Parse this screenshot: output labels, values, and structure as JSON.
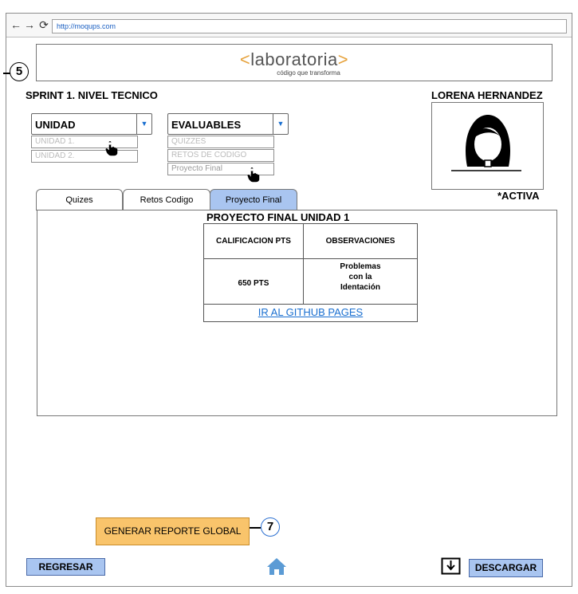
{
  "browser": {
    "url": "http://moqups.com",
    "icons": {
      "back": "arrow-left",
      "forward": "arrow-right",
      "reload": "reload"
    }
  },
  "logo": {
    "open_bracket": "<",
    "name": "laboratoria",
    "close_bracket": ">",
    "tagline": "código que transforma"
  },
  "steps": {
    "top": "5",
    "bottom": "7"
  },
  "header": {
    "sprint_title": "SPRINT 1.  NIVEL TECNICO",
    "student_name": "LORENA HERNANDEZ",
    "student_status": "*ACTIVA"
  },
  "filters": {
    "unidad": {
      "label": "UNIDAD",
      "options": [
        "UNIDAD 1.",
        "UNIDAD 2."
      ]
    },
    "evaluables": {
      "label": "EVALUABLES",
      "options": [
        "QUIZZES",
        "RETOS DE CODIGO",
        "Proyecto Final"
      ]
    }
  },
  "tabs": [
    {
      "label": "Quizes",
      "active": false
    },
    {
      "label": "Retos Codigo",
      "active": false
    },
    {
      "label": "Proyecto Final",
      "active": true
    }
  ],
  "panel": {
    "title": "PROYECTO FINAL UNIDAD 1",
    "table": {
      "headers": [
        "CALIFICACION PTS",
        "OBSERVACIONES"
      ],
      "row": [
        "650 PTS",
        "Problemas con la Identación"
      ]
    },
    "link_label": "IR AL GITHUB PAGES"
  },
  "actions": {
    "generate_report": "GENERAR REPORTE GLOBAL",
    "back": "REGRESAR",
    "download": "DESCARGAR"
  },
  "colors": {
    "accent_blue": "#a9c5f0",
    "accent_orange": "#f9c46b",
    "link_blue": "#1a6fd0",
    "logo_bracket": "#e6a23c"
  }
}
